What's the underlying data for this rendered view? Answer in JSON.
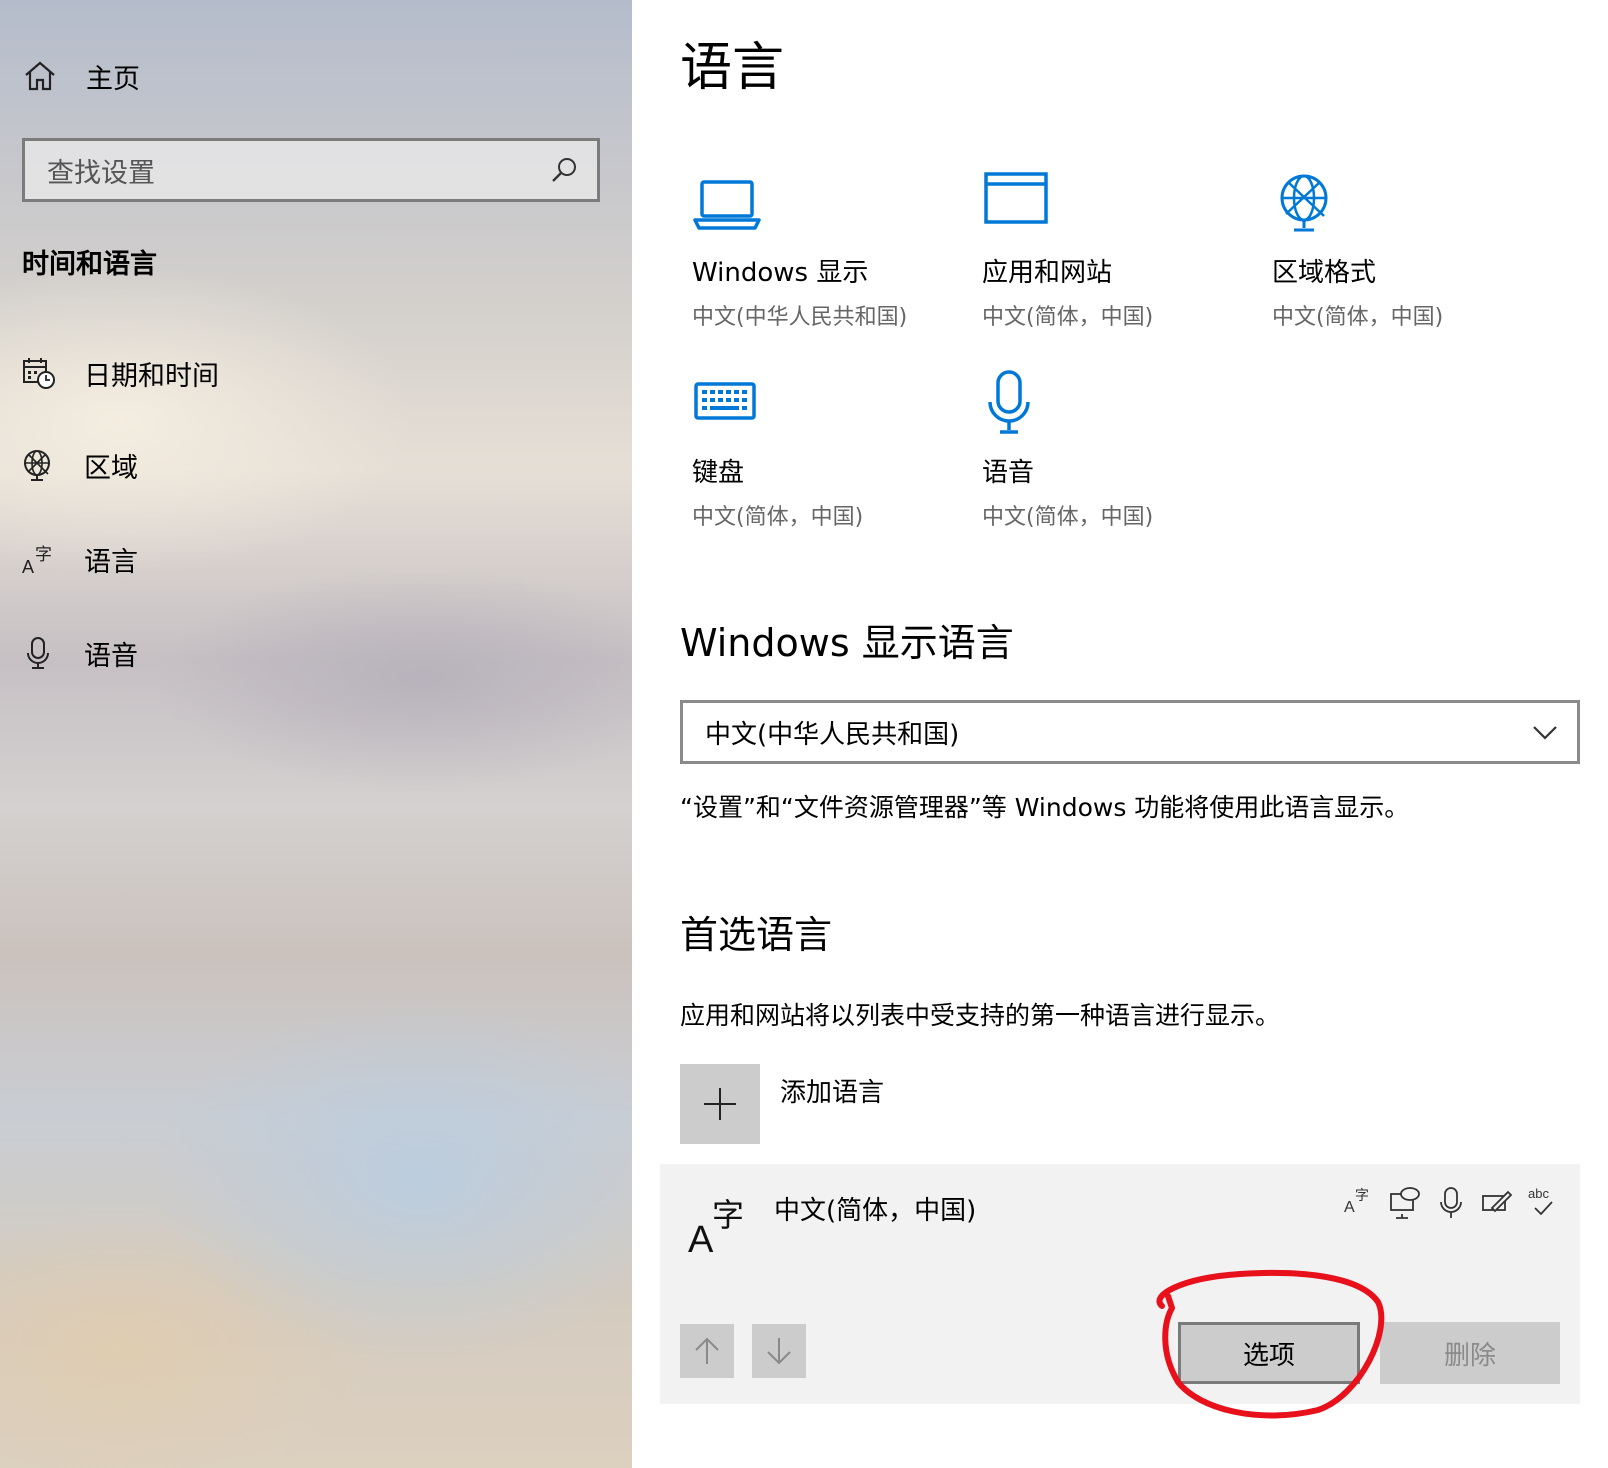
{
  "sidebar": {
    "home_label": "主页",
    "search_placeholder": "查找设置",
    "section_title": "时间和语言",
    "items": [
      {
        "label": "日期和时间",
        "icon": "calendar-clock-icon"
      },
      {
        "label": "区域",
        "icon": "globe-icon"
      },
      {
        "label": "语言",
        "icon": "language-icon"
      },
      {
        "label": "语音",
        "icon": "microphone-icon"
      }
    ]
  },
  "main": {
    "title": "语言",
    "tiles": [
      {
        "name": "Windows 显示",
        "sub": "中文(中华人民共和国)",
        "icon": "laptop-icon"
      },
      {
        "name": "应用和网站",
        "sub": "中文(简体，中国)",
        "icon": "window-icon"
      },
      {
        "name": "区域格式",
        "sub": "中文(简体，中国)",
        "icon": "globe-icon"
      },
      {
        "name": "键盘",
        "sub": "中文(简体，中国)",
        "icon": "keyboard-icon"
      },
      {
        "name": "语音",
        "sub": "中文(简体，中国)",
        "icon": "microphone-icon"
      }
    ],
    "display_language": {
      "heading": "Windows 显示语言",
      "selected": "中文(中华人民共和国)",
      "description": "“设置”和“文件资源管理器”等 Windows 功能将使用此语言显示。"
    },
    "preferred": {
      "heading": "首选语言",
      "description": "应用和网站将以列表中受支持的第一种语言进行显示。",
      "add_label": "添加语言",
      "language_name": "中文(简体，中国)",
      "options_label": "选项",
      "remove_label": "删除"
    }
  },
  "colors": {
    "accent": "#0078d7",
    "annotation": "#e8101a"
  }
}
